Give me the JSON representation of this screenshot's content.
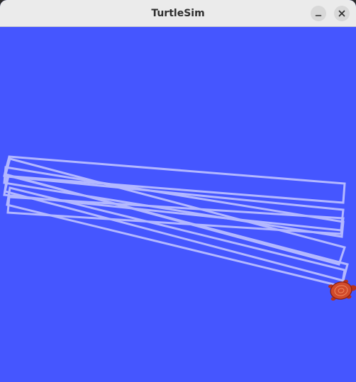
{
  "window": {
    "title": "TurtleSim"
  },
  "titlebar": {
    "minimize_icon": "minimize-icon",
    "close_icon": "close-icon"
  },
  "canvas": {
    "background_color": "#4556ff",
    "pen_color": "#b3b8ff",
    "turtle_color": "#d0492b"
  }
}
